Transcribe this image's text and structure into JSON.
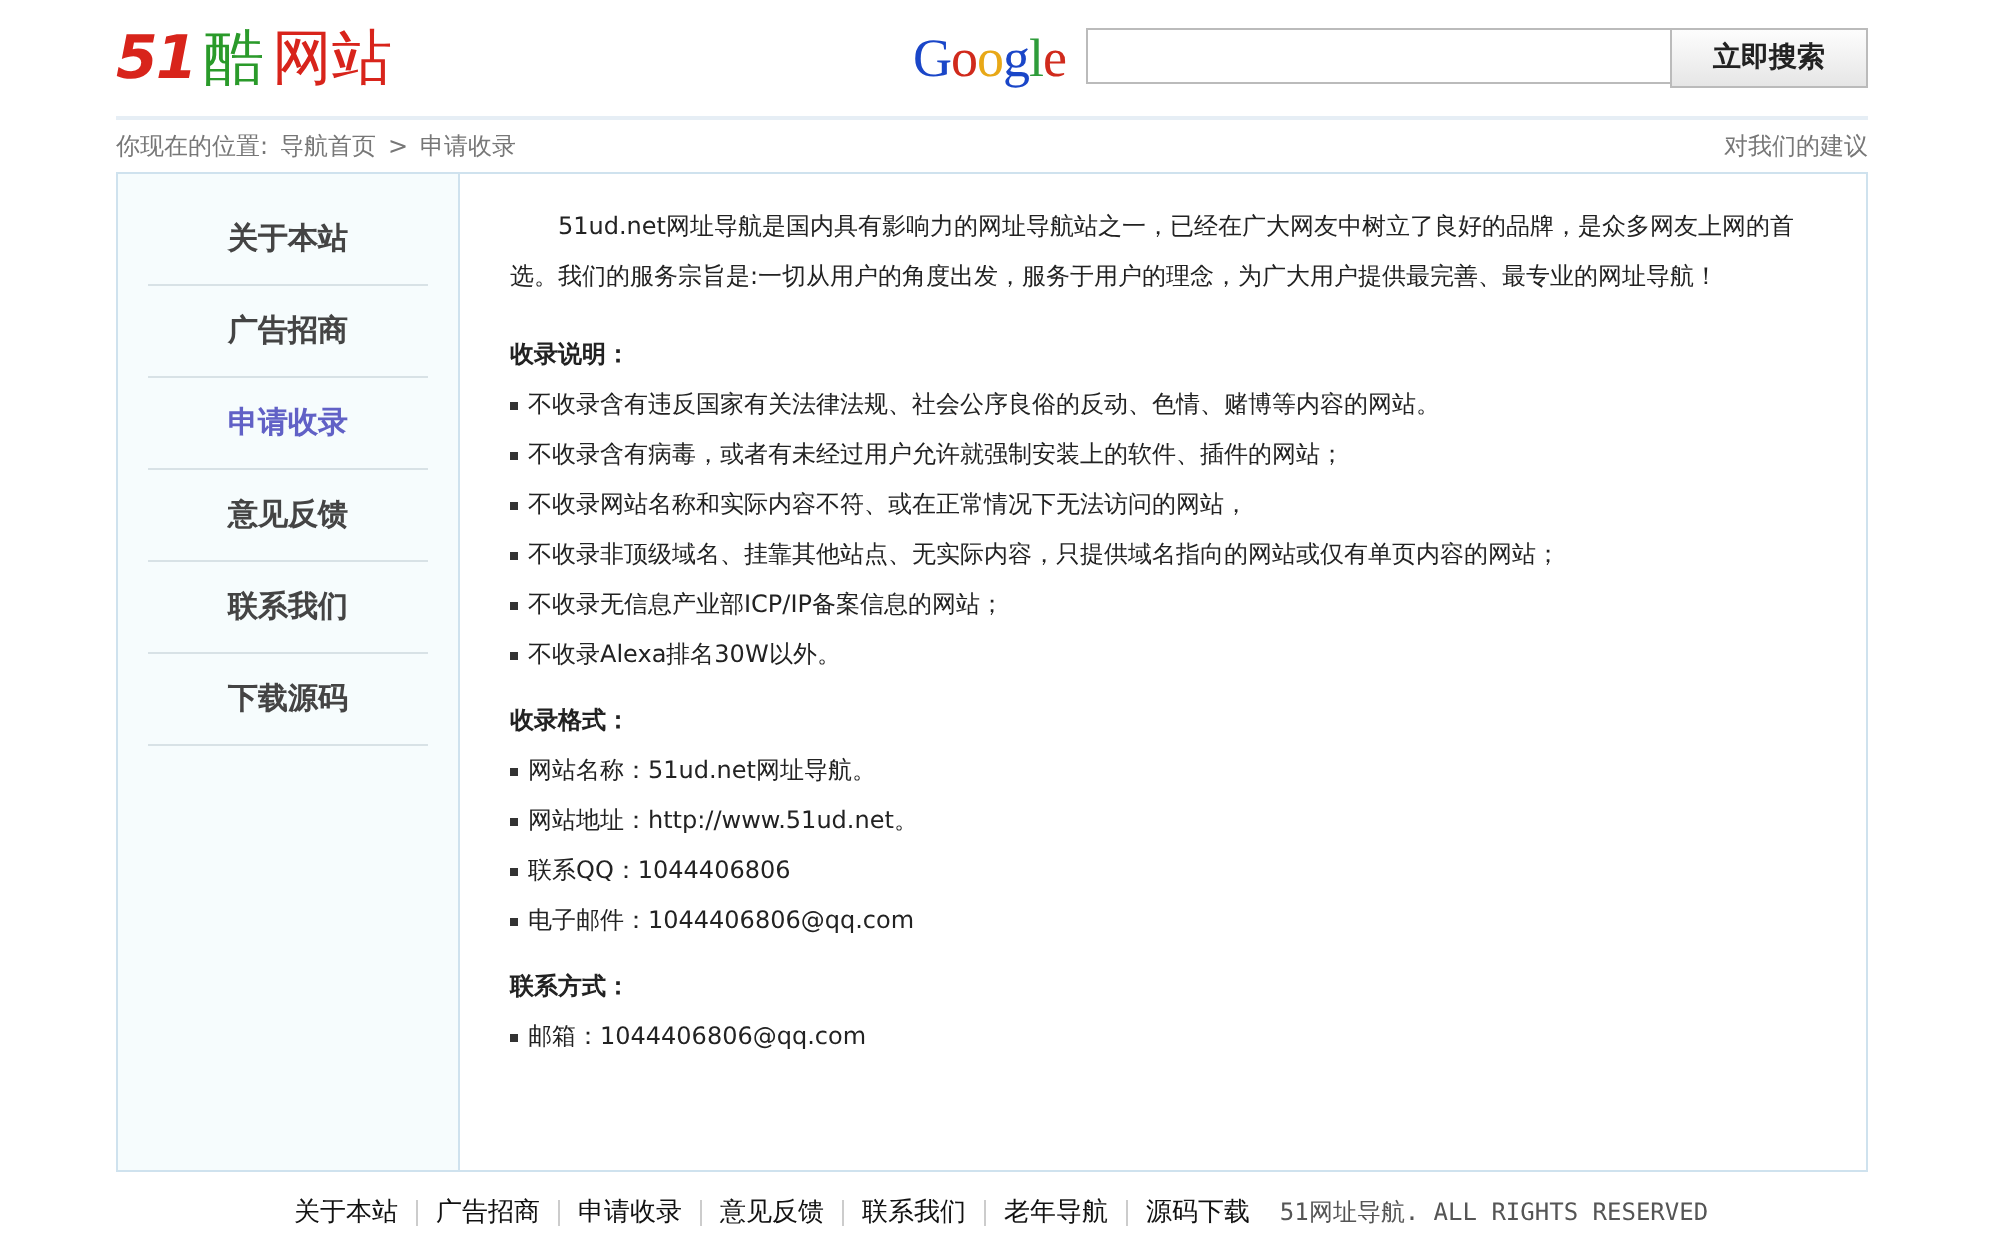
{
  "logo": {
    "number": "51",
    "word": "酷",
    "rest": "网站"
  },
  "search": {
    "brand": "Google",
    "button": "立即搜索"
  },
  "breadcrumb": {
    "prefix": "你现在的位置:",
    "items": [
      "导航首页",
      "申请收录"
    ],
    "separator": ">",
    "feedback_link": "对我们的建议"
  },
  "sidebar": {
    "items": [
      {
        "label": "关于本站",
        "selected": false
      },
      {
        "label": "广告招商",
        "selected": false
      },
      {
        "label": "申请收录",
        "selected": true
      },
      {
        "label": "意见反馈",
        "selected": false
      },
      {
        "label": "联系我们",
        "selected": false
      },
      {
        "label": "下载源码",
        "selected": false
      }
    ]
  },
  "content": {
    "intro": "51ud.net网址导航是国内具有影响力的网址导航站之一，已经在广大网友中树立了良好的品牌，是众多网友上网的首选。我们的服务宗旨是:一切从用户的角度出发，服务于用户的理念，为广大用户提供最完善、最专业的网址导航！",
    "sections": [
      {
        "heading": "收录说明：",
        "items": [
          "不收录含有违反国家有关法律法规、社会公序良俗的反动、色情、赌博等内容的网站。",
          "不收录含有病毒，或者有未经过用户允许就强制安装上的软件、插件的网站；",
          "不收录网站名称和实际内容不符、或在正常情况下无法访问的网站，",
          "不收录非顶级域名、挂靠其他站点、无实际内容，只提供域名指向的网站或仅有单页内容的网站；",
          "不收录无信息产业部ICP/IP备案信息的网站；",
          "不收录Alexa排名30W以外。"
        ]
      },
      {
        "heading": "收录格式：",
        "items": [
          "网站名称：51ud.net网址导航。",
          "网站地址：http://www.51ud.net。",
          "联系QQ：1044406806",
          "电子邮件：1044406806@qq.com"
        ]
      },
      {
        "heading": "联系方式：",
        "items": [
          "邮箱：1044406806@qq.com"
        ]
      }
    ]
  },
  "footer": {
    "links": [
      "关于本站",
      "广告招商",
      "申请收录",
      "意见反馈",
      "联系我们",
      "老年导航",
      "源码下载"
    ],
    "copyright": "51网址导航. ALL RIGHTS RESERVED"
  }
}
